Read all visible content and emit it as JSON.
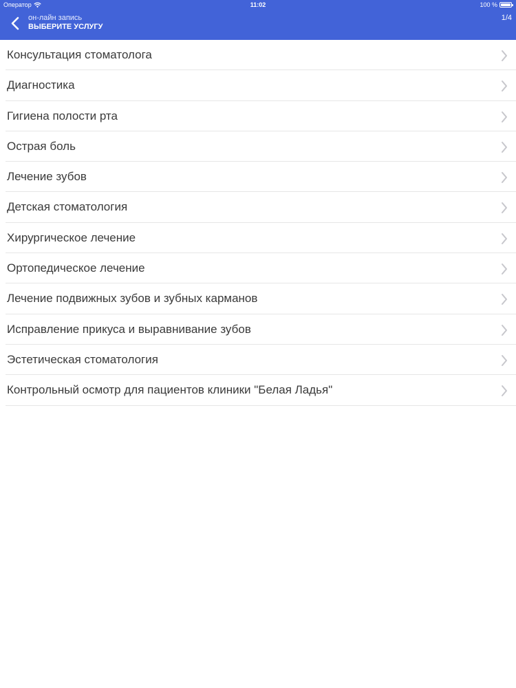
{
  "status_bar": {
    "carrier": "Оператор",
    "time": "11:02",
    "battery": "100 %",
    "wifi_icon": "wifi-icon",
    "battery_icon": "battery-icon"
  },
  "nav": {
    "back_icon": "chevron-left-icon",
    "subtitle": "он-лайн запись",
    "title": "ВЫБЕРИТЕ УСЛУГУ",
    "page_counter": "1/4"
  },
  "colors": {
    "header_bg": "#4263d8",
    "text": "#3a3a3a",
    "separator": "#e6e6e6",
    "chevron": "#c7c7cc"
  },
  "services": [
    {
      "label": "Консультация стоматолога"
    },
    {
      "label": "Диагностика"
    },
    {
      "label": "Гигиена полости рта"
    },
    {
      "label": "Острая боль"
    },
    {
      "label": "Лечение зубов"
    },
    {
      "label": "Детская стоматология"
    },
    {
      "label": "Хирургическое лечение"
    },
    {
      "label": "Ортопедическое лечение"
    },
    {
      "label": "Лечение подвижных зубов и зубных карманов"
    },
    {
      "label": "Исправление прикуса и выравнивание зубов"
    },
    {
      "label": "Эстетическая стоматология"
    },
    {
      "label": "Контрольный осмотр для пациентов клиники \"Белая Ладья\""
    }
  ]
}
